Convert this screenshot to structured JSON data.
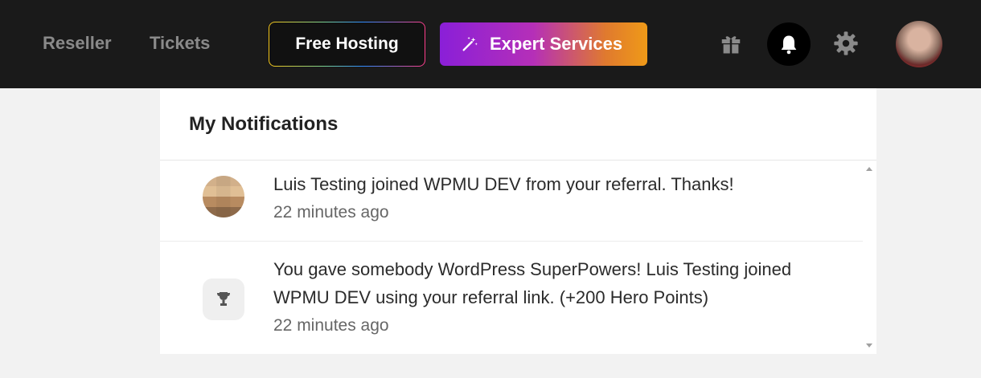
{
  "nav": {
    "links": [
      "Reseller",
      "Tickets"
    ],
    "free_hosting_label": "Free Hosting",
    "expert_services_label": "Expert Services",
    "icons": [
      "magic-wand-icon",
      "gift-icon",
      "bell-icon",
      "gear-icon",
      "user-avatar"
    ]
  },
  "notifications": {
    "title": "My Notifications",
    "items": [
      {
        "message": "Luis Testing joined WPMU DEV from your referral. Thanks!",
        "time": "22 minutes ago",
        "icon": "user-avatar"
      },
      {
        "message": "You gave somebody WordPress SuperPowers! Luis Testing joined WPMU DEV using your referral link. (+200 Hero Points)",
        "time": "22 minutes ago",
        "icon": "trophy-icon"
      }
    ]
  },
  "colors": {
    "topbar": "#1a1a1a",
    "expert_gradient_start": "#8a1fd8",
    "expert_gradient_end": "#ef9a18",
    "page_background": "#f2f2f2"
  }
}
